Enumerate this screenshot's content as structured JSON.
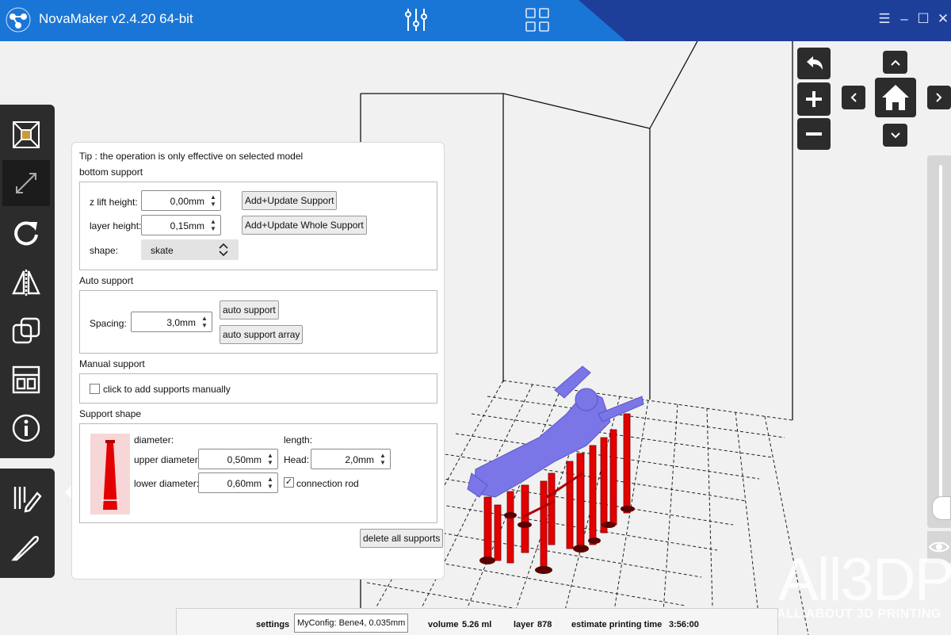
{
  "titlebar": {
    "title": "NovaMaker v2.4.20 64-bit",
    "menu_icon": "menu-icon",
    "minimize_icon": "minimize-icon",
    "maximize_icon": "maximize-icon",
    "close_icon": "close-icon",
    "mode_icons": [
      "sliders-icon",
      "grid-icon"
    ],
    "colors": {
      "blue": "#1a76d6",
      "dark": "#1d3f9a"
    }
  },
  "left_toolbar": {
    "tools": [
      "fit-model-icon",
      "resize-icon",
      "rotate-icon",
      "mirror-icon",
      "duplicate-icon",
      "layout-icon",
      "info-icon"
    ],
    "bottom_tools": [
      "support-edit-icon",
      "slice-icon"
    ]
  },
  "support_panel": {
    "tip": "Tip : the operation is only effective on selected model",
    "bottom_support": {
      "title": "bottom support",
      "z_lift_label": "z lift height:",
      "z_lift_value": "0,00mm",
      "layer_height_label": "layer height:",
      "layer_height_value": "0,15mm",
      "shape_label": "shape:",
      "shape_value": "skate",
      "add_update_btn": "Add+Update Support",
      "add_update_whole_btn": "Add+Update Whole Support"
    },
    "auto_support": {
      "title": "Auto support",
      "spacing_label": "Spacing:",
      "spacing_value": "3,0mm",
      "auto_btn": "auto support",
      "auto_array_btn": "auto support array"
    },
    "manual_support": {
      "title": "Manual support",
      "checkbox_label": "click to add supports manually",
      "checked": false
    },
    "support_shape": {
      "title": "Support shape",
      "diameter_label": "diameter:",
      "length_label": "length:",
      "upper_label": "upper diameter:",
      "upper_value": "0,50mm",
      "head_label": "Head:",
      "head_value": "2,0mm",
      "lower_label": "lower diameter:",
      "lower_value": "0,60mm",
      "connection_label": "connection rod",
      "connection_checked": true
    },
    "delete_btn": "delete all supports"
  },
  "right_nav": {
    "undo_icon": "undo-icon",
    "zoom_in_icon": "plus-icon",
    "zoom_out_icon": "minus-icon",
    "home_icon": "home-icon",
    "arrow_icons": [
      "chevron-up-icon",
      "chevron-left-icon",
      "chevron-right-icon",
      "chevron-down-icon"
    ],
    "eye_icon": "eye-icon"
  },
  "statusbar": {
    "settings_label": "settings",
    "config_value": "MyConfig: Bene4, 0.035mm",
    "volume_label": "volume",
    "volume_value": "5.26 ml",
    "layer_label": "layer",
    "layer_value": "878",
    "time_label": "estimate printing time",
    "time_value": "3:56:00"
  },
  "watermark": {
    "main": "All3DP",
    "sub": "ALL ABOUT 3D PRINTING"
  }
}
